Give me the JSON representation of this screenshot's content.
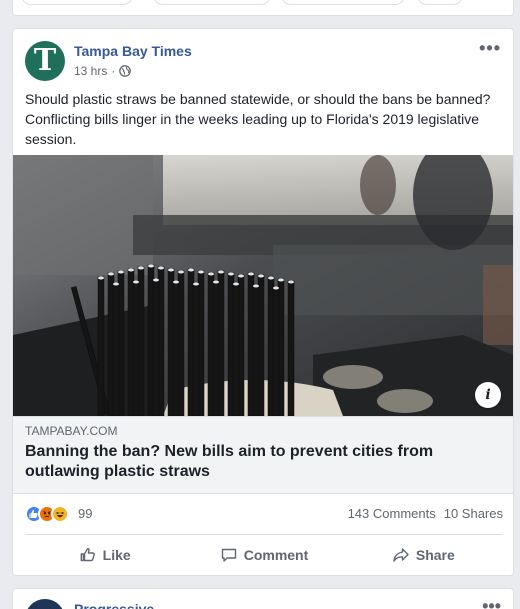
{
  "post": {
    "page_name": "Tampa Bay Times",
    "avatar_letter": "T",
    "time": "13 hrs",
    "separator": "·",
    "text": "Should plastic straws be banned statewide, or should the bans be banned? Conflicting bills linger in the weeks leading up to Florida's 2019 legislative session.",
    "more_glyph": "•••",
    "link": {
      "domain": "TAMPABAY.COM",
      "headline": "Banning the ban? New bills aim to prevent cities from outlawing plastic straws",
      "info_glyph": "i"
    },
    "reactions": {
      "icons": [
        "like-icon",
        "angry-icon",
        "haha-icon"
      ],
      "count": "99",
      "comments": "143 Comments",
      "shares": "10 Shares"
    },
    "actions": {
      "like": "Like",
      "comment": "Comment",
      "share": "Share"
    }
  },
  "next_post": {
    "page_name": "Progressive",
    "more_glyph": "•••"
  },
  "colors": {
    "link_blue": "#385898",
    "background": "#e9ebee",
    "avatar_green": "#1f6f5a"
  }
}
